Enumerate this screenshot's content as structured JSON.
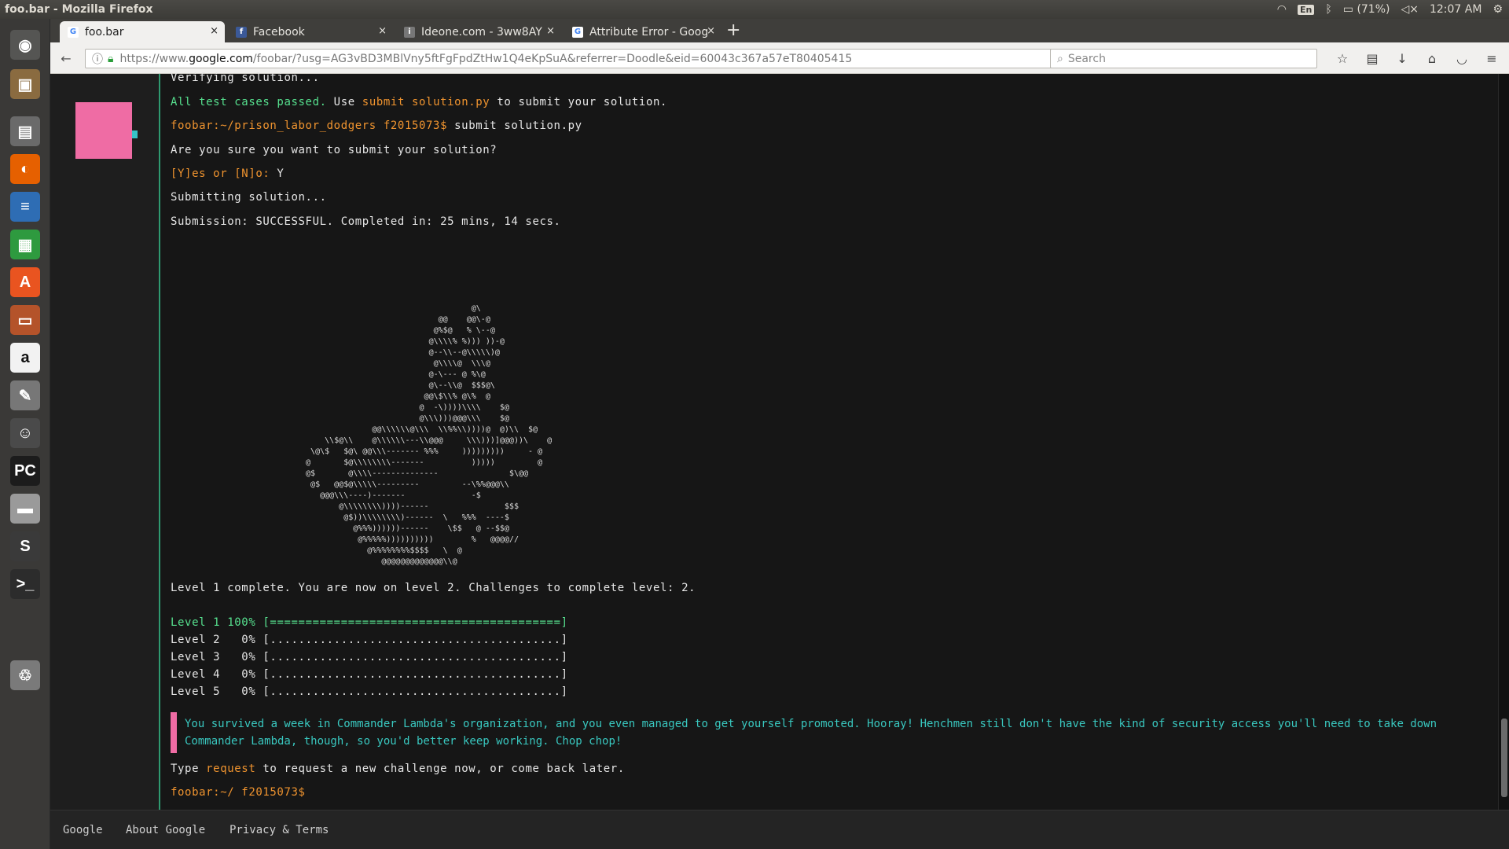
{
  "os": {
    "window_title": "foo.bar - Mozilla Firefox",
    "language": "En",
    "battery": "(71%)",
    "clock": "12:07 AM"
  },
  "launcher": [
    {
      "name": "ubuntu-dash-icon",
      "glyph": "◉",
      "bg": "#555553"
    },
    {
      "name": "files-icon",
      "glyph": "▣",
      "bg": "#8a6b40"
    },
    {
      "name": "file-manager-icon",
      "glyph": "▤",
      "bg": "#6a6a6a"
    },
    {
      "name": "firefox-icon",
      "glyph": "◐",
      "bg": "#e66000"
    },
    {
      "name": "writer-icon",
      "glyph": "≡",
      "bg": "#2e6db4"
    },
    {
      "name": "calc-icon",
      "glyph": "▦",
      "bg": "#2e9a3f"
    },
    {
      "name": "software-center-icon",
      "glyph": "A",
      "bg": "#e95420"
    },
    {
      "name": "impress-icon",
      "glyph": "▭",
      "bg": "#b4532a"
    },
    {
      "name": "amazon-icon",
      "glyph": "a",
      "bg": "#f2f2f2"
    },
    {
      "name": "system-settings-icon",
      "glyph": "✎",
      "bg": "#777"
    },
    {
      "name": "pidgin-icon",
      "glyph": "☺",
      "bg": "#4a4a4a"
    },
    {
      "name": "pycharm-icon",
      "glyph": "PC",
      "bg": "#1c1c1c"
    },
    {
      "name": "disk-icon",
      "glyph": "▬",
      "bg": "#9a9a9a"
    },
    {
      "name": "sublime-icon",
      "glyph": "S",
      "bg": "#3a3a3a"
    },
    {
      "name": "terminal-icon",
      "glyph": ">_",
      "bg": "#2c2c2c"
    },
    {
      "name": "trash-icon",
      "glyph": "♲",
      "bg": "#7a7a7a"
    }
  ],
  "tabs": [
    {
      "label": "foo.bar",
      "fav": "G"
    },
    {
      "label": "Facebook",
      "fav": "f"
    },
    {
      "label": "Ideone.com - 3ww8AY",
      "fav": "i"
    },
    {
      "label": "Attribute Error - Googl",
      "fav": "G"
    }
  ],
  "url": {
    "prefix": "https://www.",
    "domain": "google.com",
    "rest": "/foobar/?usg=AG3vBD3MBlVny5ftFgFpdZtHw1Q4eKpSuA&referrer=Doodle&eid=60043c367a57eT80405415"
  },
  "search_placeholder": "Search",
  "terminal": {
    "l_verifying": "Verifying solution...",
    "l_passed": "All test cases passed.",
    "l_use": " Use ",
    "l_submit_cmd": "submit solution.py",
    "l_to_submit": " to submit your solution.",
    "prompt1": "foobar:~/prison_labor_dodgers f2015073$",
    "cmd1": " submit solution.py",
    "l_confirm": "Are you sure you want to submit your solution?",
    "l_yn": "[Y]es or [N]o:",
    "l_yn_ans": " Y",
    "l_submitting": "Submitting solution...",
    "l_result": "Submission: SUCCESSFUL. Completed in: 25 mins, 14 secs.",
    "l_level_complete": "Level 1 complete. You are now on level 2. Challenges to complete level: 2.",
    "levels": [
      {
        "label": "Level 1",
        "pct": "100%",
        "bar": "[=========================================]",
        "progress": 1.0
      },
      {
        "label": "Level 2",
        "pct": "  0%",
        "bar": "[.........................................]",
        "progress": 0.0
      },
      {
        "label": "Level 3",
        "pct": "  0%",
        "bar": "[.........................................]",
        "progress": 0.0
      },
      {
        "label": "Level 4",
        "pct": "  0%",
        "bar": "[.........................................]",
        "progress": 0.0
      },
      {
        "label": "Level 5",
        "pct": "  0%",
        "bar": "[.........................................]",
        "progress": 0.0
      }
    ],
    "callout": "You survived a week in Commander Lambda's organization, and you even managed to get yourself promoted. Hooray! Henchmen still don't have the kind of security access you'll need to take down Commander Lambda, though, so you'd better keep working. Chop chop!",
    "l_type": "Type ",
    "l_request": "request",
    "l_request_rest": " to request a new challenge now, or come back later.",
    "prompt2": "foobar:~/ f2015073$"
  },
  "ascii_art": "                                     @\\\n                              @@    @@\\-@\n                             @%$@   % \\--@\n                            @\\\\\\\\% %))) ))-@\n                            @--\\\\--@\\\\\\\\\\)@\n                             @\\\\\\\\@  \\\\\\@\n                            @-\\--- @ %\\@\n                            @\\--\\\\@  $$$@\\\n                           @@\\$\\\\% @\\%  @\n                          @  -\\))))\\\\\\\\    $@\n                          @\\\\\\)))@@@\\\\\\    $@\n                @@\\\\\\\\\\\\@\\\\\\  \\\\%%\\\\))))@  @)\\\\  $@\n      \\\\$@\\\\    @\\\\\\\\\\\\---\\\\@@@     \\\\\\)))]@@@))\\    @\n   \\@\\$   $@\\ @@\\\\\\------- %%%     )))))))))     - @\n  @       $@\\\\\\\\\\\\\\\\-------          )))))         @\n  @$       @\\\\\\\\--------------               $\\@@\n   @$   @@$@\\\\\\\\\\---------         --\\%%@@@\\\\\n     @@@\\\\\\----)-------              -$\n         @\\\\\\\\\\\\\\\\))))------                $$$\n          @$))\\\\\\\\\\\\\\\\)------  \\   %%%  ----$\n            @%%%))))))------    \\$$   @ --$$@\n             @%%%%%))))))))))        %   @@@@//\n               @%%%%%%%%$$$$   \\  @\n                  @@@@@@@@@@@@@\\\\@",
  "footer": {
    "google": "Google",
    "about": "About Google",
    "privacy": "Privacy & Terms"
  }
}
